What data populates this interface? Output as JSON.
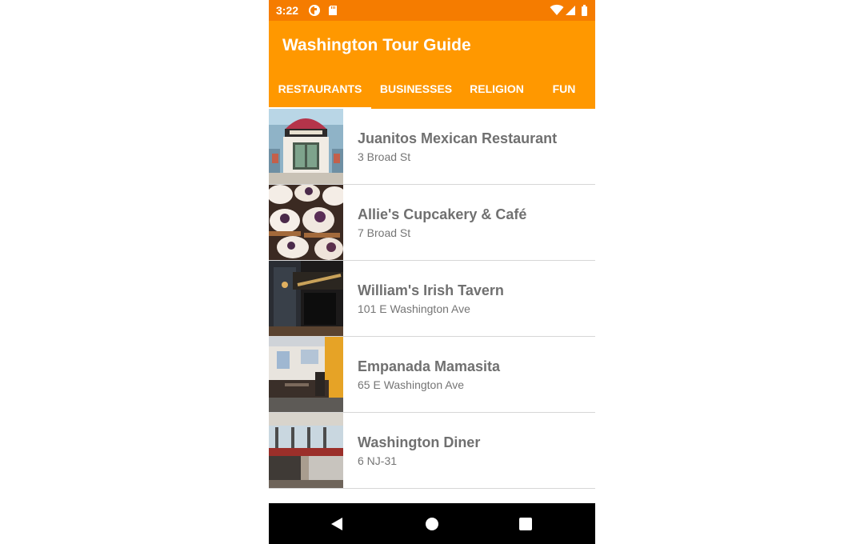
{
  "status_bar": {
    "time": "3:22",
    "left_icons": [
      "app-notification-icon",
      "sd-card-icon"
    ],
    "right_icons": [
      "wifi-icon",
      "cell-signal-icon",
      "battery-icon"
    ],
    "color": "#f57c00"
  },
  "app_bar": {
    "title": "Washington Tour Guide",
    "color": "#ff9800"
  },
  "tabs": [
    {
      "label": "RESTAURANTS",
      "selected": true
    },
    {
      "label": "BUSINESSES",
      "selected": false
    },
    {
      "label": "RELIGION",
      "selected": false
    },
    {
      "label": "FUN",
      "selected": false
    }
  ],
  "places": [
    {
      "name": "Juanitos Mexican Restaurant",
      "address": "3 Broad St",
      "image": "restaurant-storefront-photo"
    },
    {
      "name": "Allie's Cupcakery & Café",
      "address": "7 Broad St",
      "image": "cupcakes-photo"
    },
    {
      "name": "William's Irish Tavern",
      "address": "101 E Washington Ave",
      "image": "tavern-sign-photo"
    },
    {
      "name": "Empanada Mamasita",
      "address": "65 E Washington Ave",
      "image": "restaurant-interior-photo"
    },
    {
      "name": "Washington Diner",
      "address": "6 NJ-31",
      "image": "diner-interior-photo"
    }
  ],
  "nav_bar": {
    "buttons": [
      "back-icon",
      "home-icon",
      "recents-icon"
    ]
  }
}
